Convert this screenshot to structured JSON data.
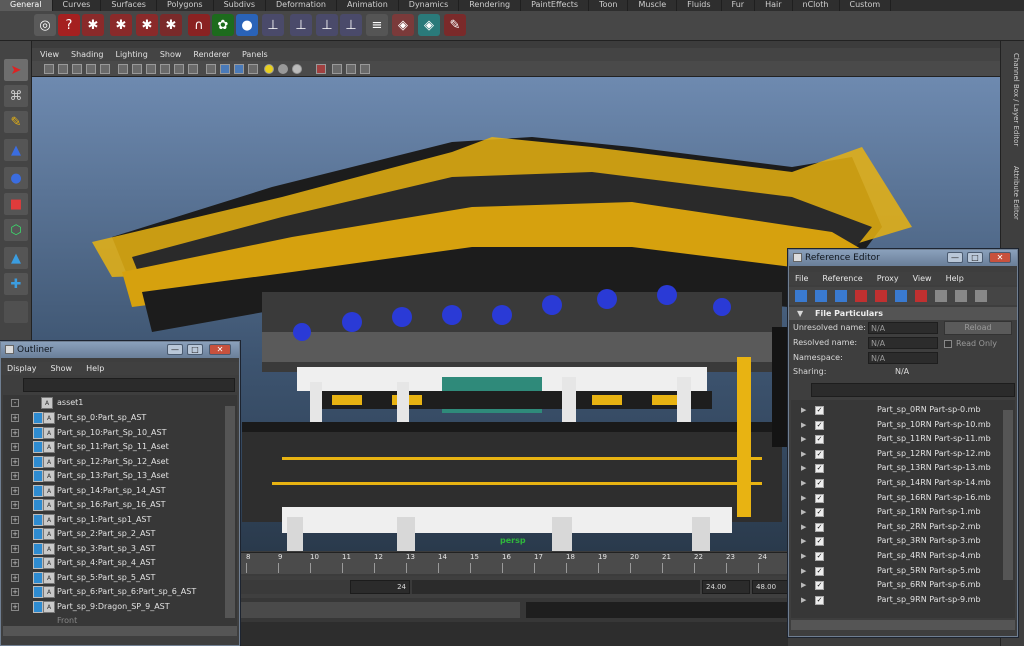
{
  "shelf": {
    "tabs": [
      "General",
      "Curves",
      "Surfaces",
      "Polygons",
      "Subdivs",
      "Deformation",
      "Animation",
      "Dynamics",
      "Rendering",
      "PaintEffects",
      "Toon",
      "Muscle",
      "Fluids",
      "Fur",
      "Hair",
      "nCloth",
      "Custom"
    ],
    "active_tab": "General"
  },
  "panel": {
    "menus": [
      "View",
      "Shading",
      "Lighting",
      "Show",
      "Renderer",
      "Panels"
    ],
    "camera_label": "persp"
  },
  "right_strip": {
    "channel_tab": "Channel Box / Layer Editor",
    "attribute_tab": "Attribute Editor"
  },
  "timeline": {
    "ticks": [
      "8",
      "9",
      "10",
      "11",
      "12",
      "13",
      "14",
      "15",
      "16",
      "17",
      "18",
      "19",
      "20",
      "21",
      "22",
      "23",
      "24"
    ],
    "current_frame": "24",
    "end_frame": "24.00",
    "range_end": "48.00"
  },
  "outliner": {
    "title": "Outliner",
    "menus": [
      "Display",
      "Show",
      "Help"
    ],
    "root": "asset1",
    "items": [
      "Part_sp_0:Part_sp_AST",
      "Part_sp_10:Part_Sp_10_AST",
      "Part_sp_11:Part_Sp_11_Aset",
      "Part_sp_12:Part_Sp_12_Aset",
      "Part_sp_13:Part_Sp_13_Aset",
      "Part_sp_14:Part_sp_14_AST",
      "Part_sp_16:Part_sp_16_AST",
      "Part_sp_1:Part_sp1_AST",
      "Part_sp_2:Part_sp_2_AST",
      "Part_sp_3:Part_sp_3_AST",
      "Part_sp_4:Part_sp_4_AST",
      "Part_sp_5:Part_sp_5_AST",
      "Part_sp_6:Part_sp_6:Part_sp_6_AST",
      "Part_sp_9:Dragon_SP_9_AST"
    ],
    "partial_item": "Front"
  },
  "reference_editor": {
    "title": "Reference Editor",
    "menus": [
      "File",
      "Reference",
      "Proxy",
      "View",
      "Help"
    ],
    "section": "File Particulars",
    "unresolved_label": "Unresolved name:",
    "unresolved_value": "N/A",
    "resolved_label": "Resolved name:",
    "resolved_value": "N/A",
    "namespace_label": "Namespace:",
    "namespace_value": "N/A",
    "sharing_label": "Sharing:",
    "sharing_value": "N/A",
    "reload_label": "Reload",
    "read_only_label": "Read Only",
    "files": [
      "Part_sp_0RN Part-sp-0.mb",
      "Part_sp_10RN Part-sp-10.mb",
      "Part_sp_11RN Part-sp-11.mb",
      "Part_sp_12RN Part-sp-12.mb",
      "Part_sp_13RN Part-sp-13.mb",
      "Part_sp_14RN Part-sp-14.mb",
      "Part_sp_16RN Part-sp-16.mb",
      "Part_sp_1RN Part-sp-1.mb",
      "Part_sp_2RN Part-sp-2.mb",
      "Part_sp_3RN Part-sp-3.mb",
      "Part_sp_4RN Part-sp-4.mb",
      "Part_sp_5RN Part-sp-5.mb",
      "Part_sp_6RN Part-sp-6.mb",
      "Part_sp_9RN Part-sp-9.mb"
    ]
  },
  "window_controls": {
    "minimize": "—",
    "maximize": "□",
    "close": "✕"
  },
  "colors": {
    "gold": "#e8b312",
    "dark_roof": "#2a2a2a",
    "dragon_blue": "#2a3ad6",
    "accent_green": "#2fb83c"
  }
}
